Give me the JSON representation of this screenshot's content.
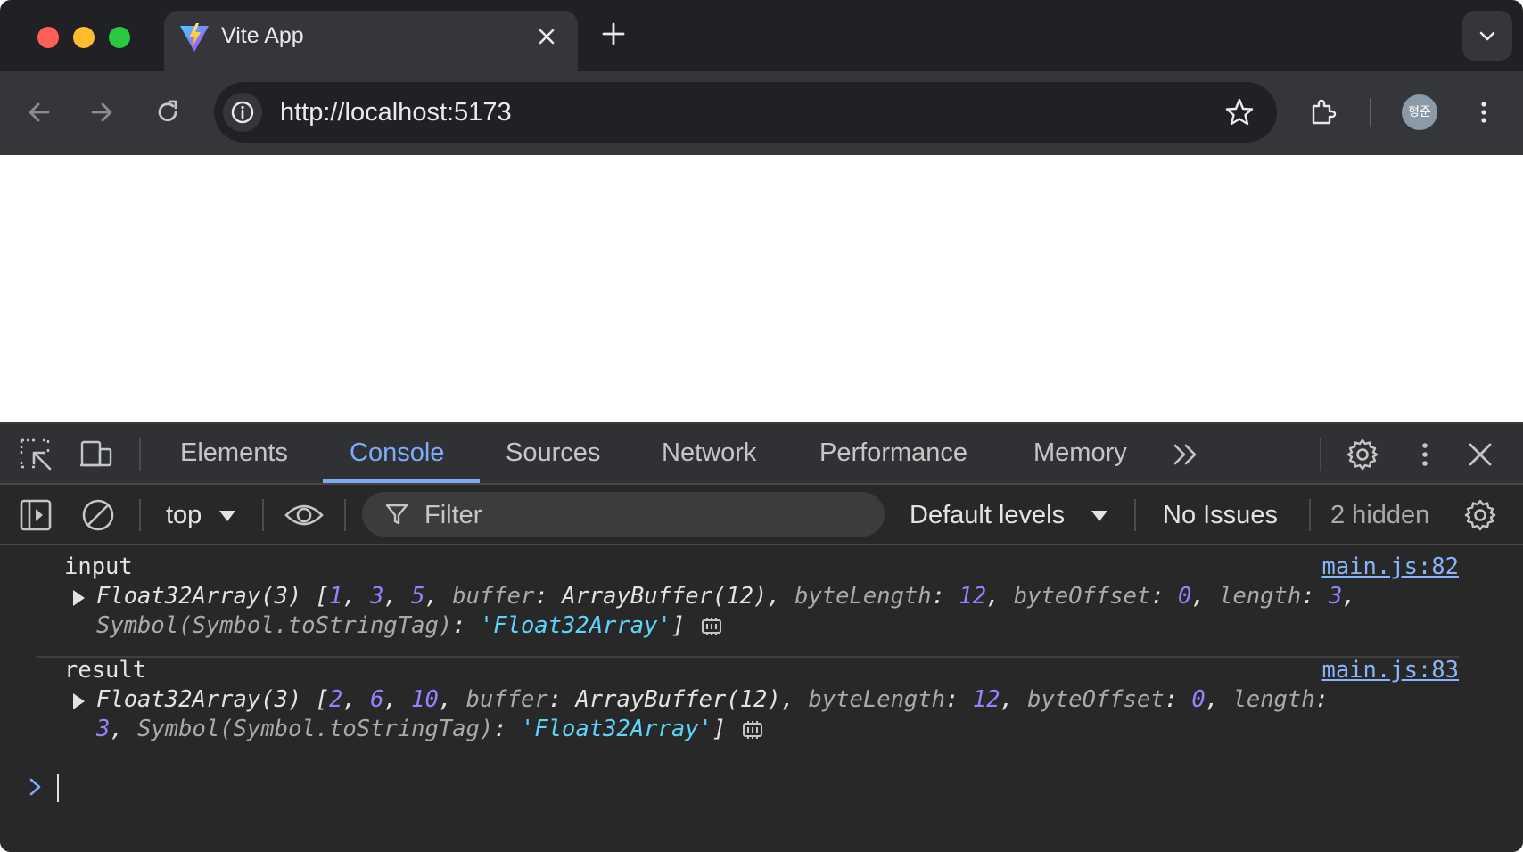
{
  "browser": {
    "tab": {
      "title": "Vite App"
    },
    "address_bar": {
      "url": "http://localhost:5173"
    },
    "profile": {
      "initials": "형준"
    }
  },
  "devtools": {
    "tabs": [
      "Elements",
      "Console",
      "Sources",
      "Network",
      "Performance",
      "Memory"
    ],
    "active_tab": "Console",
    "console_toolbar": {
      "context": "top",
      "filter_placeholder": "Filter",
      "levels": "Default levels",
      "issues": "No Issues",
      "hidden": "2 hidden"
    },
    "messages": [
      {
        "label": "input",
        "source": "main.js:82",
        "type_name": "Float32Array(3)",
        "values": [
          "1",
          "3",
          "5"
        ],
        "buffer": "ArrayBuffer(12)",
        "byteLength": "12",
        "byteOffset": "0",
        "length": "3",
        "tag": "'Float32Array'"
      },
      {
        "label": "result",
        "source": "main.js:83",
        "type_name": "Float32Array(3)",
        "values": [
          "2",
          "6",
          "10"
        ],
        "buffer": "ArrayBuffer(12)",
        "byteLength": "12",
        "byteOffset": "0",
        "length": "3",
        "tag": "'Float32Array'"
      }
    ],
    "keys": {
      "buffer": "buffer",
      "byteLength": "byteLength",
      "byteOffset": "byteOffset",
      "length": "length",
      "symbol": "Symbol(Symbol.toStringTag)"
    }
  },
  "colors": {
    "tab_strip": "#202124",
    "toolbar": "#35363a",
    "devtools_bg": "#282828",
    "accent": "#7cacf8",
    "number": "#9980ff",
    "string": "#5cd5fb",
    "link": "#8ab4f8"
  }
}
